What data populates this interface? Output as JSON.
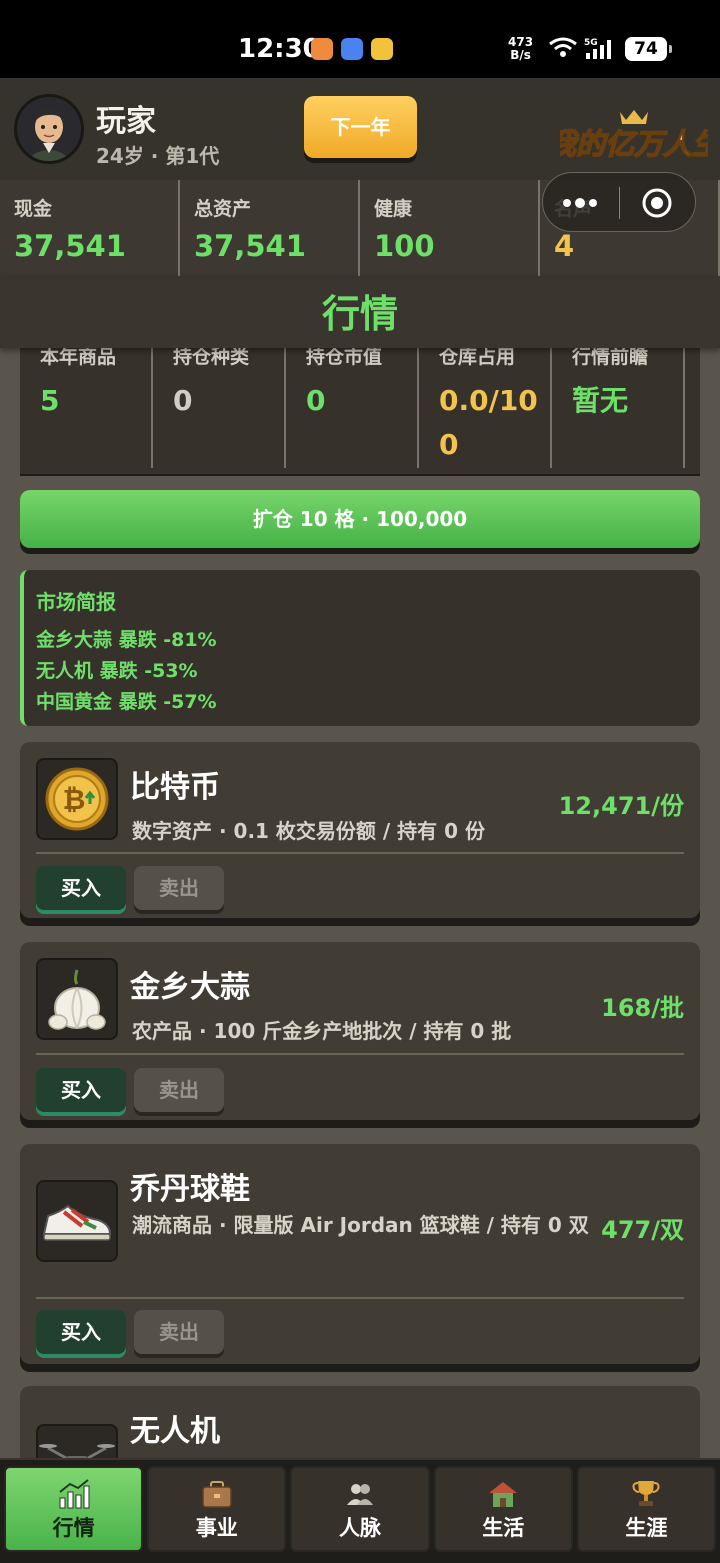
{
  "status_bar": {
    "time": "12:30",
    "net_speed_top": "473",
    "net_speed_bottom": "B/s",
    "network": "5G",
    "battery": "74"
  },
  "header": {
    "player_name": "玩家",
    "player_meta": "24岁 · 第1代",
    "next_year_label": "下一年",
    "logo_text": "我的亿万人生"
  },
  "stats": [
    {
      "label": "现金",
      "value": "37,541"
    },
    {
      "label": "总资产",
      "value": "37,541"
    },
    {
      "label": "健康",
      "value": "100"
    },
    {
      "label": "名声",
      "value": "4"
    }
  ],
  "page_title": "行情",
  "summary": [
    {
      "label": "本年商品",
      "value": "5"
    },
    {
      "label": "持仓种类",
      "value": "0"
    },
    {
      "label": "持仓市值",
      "value": "0"
    },
    {
      "label": "仓库占用",
      "value": "0.0/100"
    },
    {
      "label": "行情前瞻",
      "value": "暂无"
    }
  ],
  "expand_button": "扩仓 10 格 · 100,000",
  "market_brief": {
    "title": "市场简报",
    "lines": [
      "金乡大蒜 暴跌 -81%",
      "无人机 暴跌 -53%",
      "中国黄金 暴跌 -57%"
    ]
  },
  "goods": [
    {
      "name": "比特币",
      "desc": "数字资产 · 0.1 枚交易份额 / 持有 0 份",
      "price": "12,471/份",
      "buy": "买入",
      "sell": "卖出",
      "icon": "bitcoin-icon"
    },
    {
      "name": "金乡大蒜",
      "desc": "农产品 · 100 斤金乡产地批次 / 持有 0 批",
      "price": "168/批",
      "buy": "买入",
      "sell": "卖出",
      "icon": "garlic-icon"
    },
    {
      "name": "乔丹球鞋",
      "desc": "潮流商品 · 限量版 Air Jordan 篮球鞋 / 持有 0 双",
      "price": "477/双",
      "buy": "买入",
      "sell": "卖出",
      "icon": "sneaker-icon"
    },
    {
      "name": "无人机",
      "icon": "drone-icon"
    }
  ],
  "nav": [
    {
      "label": "行情",
      "icon": "chart-icon",
      "active": true
    },
    {
      "label": "事业",
      "icon": "briefcase-icon"
    },
    {
      "label": "人脉",
      "icon": "people-icon"
    },
    {
      "label": "生活",
      "icon": "house-icon"
    },
    {
      "label": "生涯",
      "icon": "trophy-icon"
    }
  ],
  "colors": {
    "accent_green": "#6ee06a",
    "gold": "#f4c34b",
    "button_gold": "#f0a928",
    "background": "#5a554c"
  }
}
